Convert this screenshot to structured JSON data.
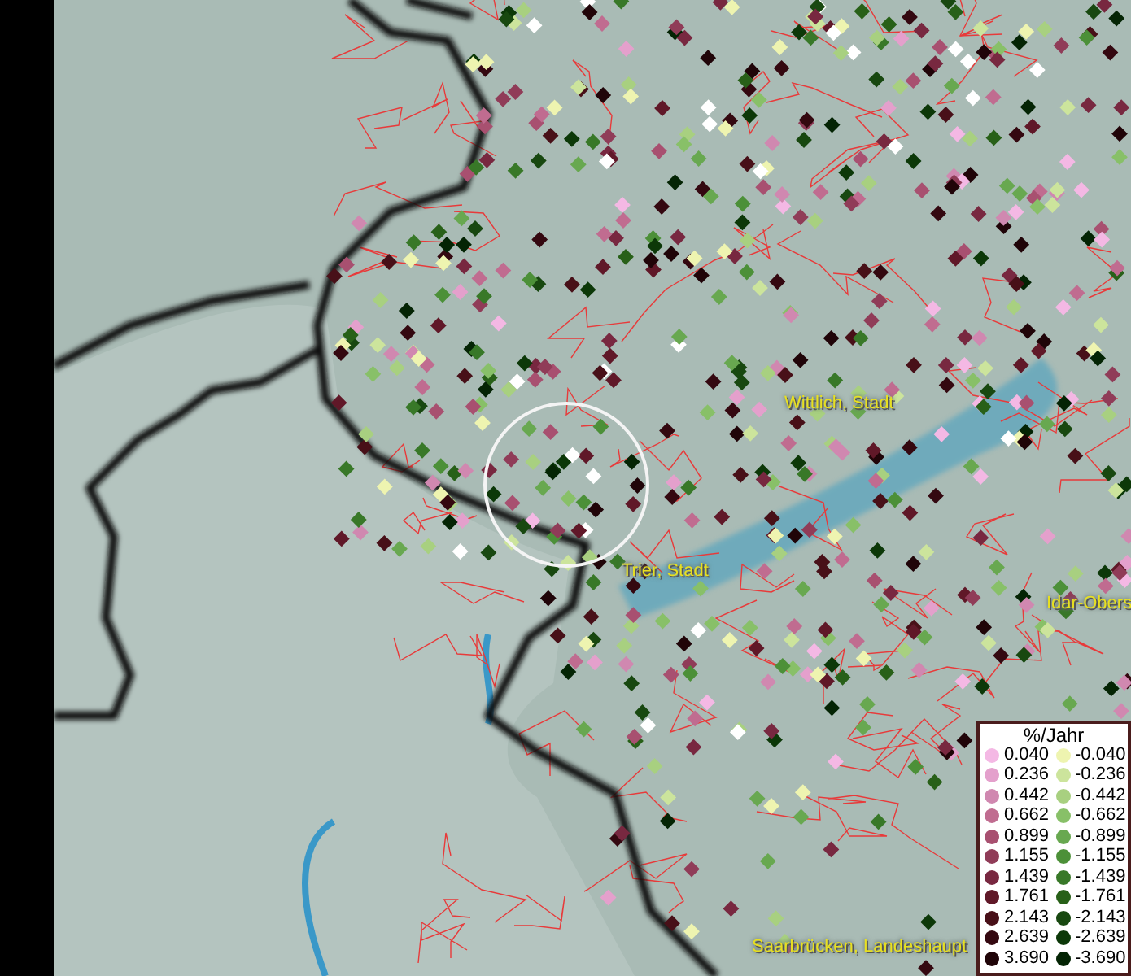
{
  "map": {
    "places": [
      {
        "name": "Wittlich, Stadt"
      },
      {
        "name": "Trier, Stadt"
      },
      {
        "name": "Idar-Obers"
      },
      {
        "name": "Saarbrücken, Landeshaupt"
      }
    ]
  },
  "legend": {
    "title": "%/Jahr",
    "positive": [
      {
        "value": "0.040",
        "color": "#f4b8e4"
      },
      {
        "value": "0.236",
        "color": "#e4a0cc"
      },
      {
        "value": "0.442",
        "color": "#d088b0"
      },
      {
        "value": "0.662",
        "color": "#c06c90"
      },
      {
        "value": "0.899",
        "color": "#a85070"
      },
      {
        "value": "1.155",
        "color": "#903c58"
      },
      {
        "value": "1.439",
        "color": "#782840"
      },
      {
        "value": "1.761",
        "color": "#601828"
      },
      {
        "value": "2.143",
        "color": "#481018"
      },
      {
        "value": "2.639",
        "color": "#340810"
      },
      {
        "value": "3.690",
        "color": "#200408"
      }
    ],
    "negative": [
      {
        "value": "-0.040",
        "color": "#eef4b0"
      },
      {
        "value": "-0.236",
        "color": "#cce49c"
      },
      {
        "value": "-0.442",
        "color": "#a8d080"
      },
      {
        "value": "-0.662",
        "color": "#88c068"
      },
      {
        "value": "-0.899",
        "color": "#68a850"
      },
      {
        "value": "-1.155",
        "color": "#4c9038"
      },
      {
        "value": "-1.439",
        "color": "#387828"
      },
      {
        "value": "-1.761",
        "color": "#286018"
      },
      {
        "value": "-2.143",
        "color": "#184810"
      },
      {
        "value": "-2.639",
        "color": "#0c3808"
      },
      {
        "value": "-3.690",
        "color": "#042404"
      }
    ]
  }
}
